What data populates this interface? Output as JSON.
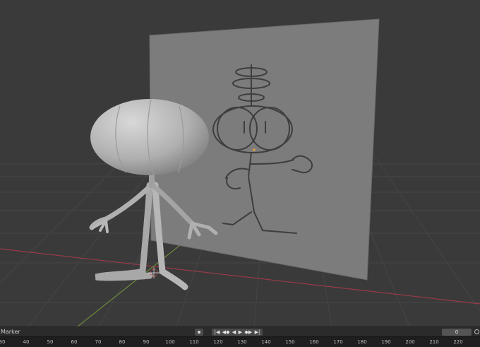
{
  "timeline": {
    "marker_label": "Marker",
    "current_frame": "0",
    "controls": [
      "|◀",
      "◀◆",
      "◀",
      "▶",
      "◆▶",
      "▶|"
    ],
    "ticks": [
      "30",
      "40",
      "50",
      "60",
      "70",
      "80",
      "90",
      "100",
      "110",
      "120",
      "130",
      "140",
      "150",
      "160",
      "170",
      "180",
      "190",
      "200",
      "210",
      "220"
    ]
  },
  "icons": {
    "record": "record-icon",
    "clock": "clock-icon",
    "origin": "3d-cursor-icon"
  },
  "colors": {
    "viewport_bg": "#3a3a3a",
    "x_axis": "#9a3a4a",
    "y_axis": "#6d8b3a",
    "mesh": "#b8b8b8",
    "plane": "#7c7c7c"
  }
}
